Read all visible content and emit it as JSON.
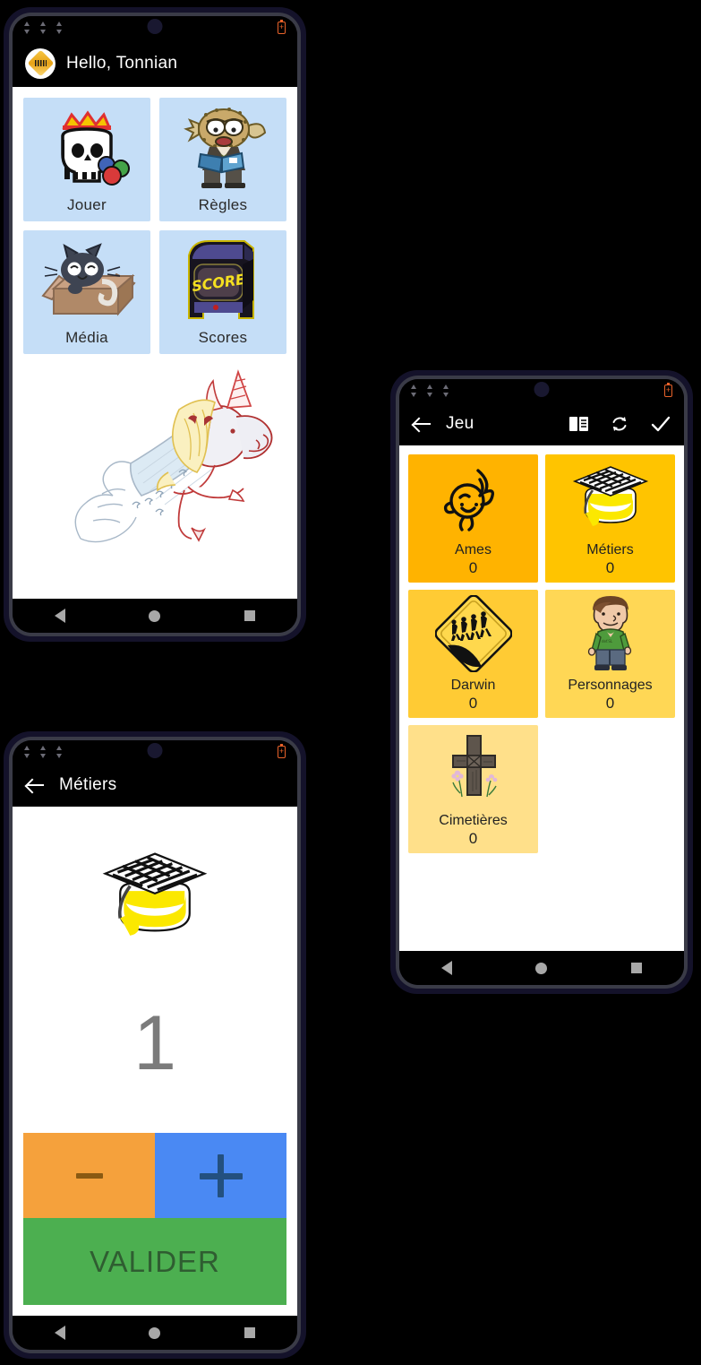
{
  "colors": {
    "tile_blue": "#c5def7",
    "amber_1": "#ffb300",
    "amber_2": "#ffc400",
    "amber_3": "#ffcb34",
    "amber_4": "#ffd755",
    "amber_5": "#ffe08a",
    "minus": "#f5a13c",
    "plus": "#4a89f3",
    "validate": "#4caf50",
    "battery": "#e8622a",
    "phone_frame": "#14122a"
  },
  "phones": {
    "home": {
      "statusbar": {
        "battery_icon": "battery-charging-icon",
        "signal_icons": [
          "data-transfer-icon",
          "data-transfer-icon",
          "data-transfer-icon"
        ]
      },
      "appbar": {
        "logo_icon": "app-logo-icon",
        "title": "Hello, Tonnian"
      },
      "tiles": [
        {
          "label": "Jouer",
          "icon": "skull-crown-icon"
        },
        {
          "label": "Règles",
          "icon": "pufferfish-teacher-icon"
        },
        {
          "label": "Média",
          "icon": "cat-in-box-icon"
        },
        {
          "label": "Scores",
          "icon": "arcade-cabinet-icon"
        }
      ],
      "hero": {
        "icon": "unicorn-mermaid-drawing"
      },
      "navbar": {
        "back": "nav-back-icon",
        "home": "nav-home-icon",
        "recents": "nav-recents-icon"
      }
    },
    "game": {
      "appbar": {
        "back_icon": "back-arrow-icon",
        "title": "Jeu",
        "actions": [
          {
            "icon": "book-icon"
          },
          {
            "icon": "refresh-icon"
          },
          {
            "icon": "check-icon"
          }
        ]
      },
      "tiles": [
        {
          "label": "Ames",
          "count": "0",
          "icon": "soul-flame-icon",
          "color": "#ffb300"
        },
        {
          "label": "Métiers",
          "count": "0",
          "icon": "graduation-cap-icon",
          "color": "#ffc400"
        },
        {
          "label": "Darwin",
          "count": "0",
          "icon": "evolution-sign-icon",
          "color": "#ffcb34"
        },
        {
          "label": "Personnages",
          "count": "0",
          "icon": "character-person-icon",
          "color": "#ffd755"
        },
        {
          "label": "Cimetières",
          "count": "0",
          "icon": "grave-cross-icon",
          "color": "#ffe08a"
        }
      ],
      "navbar": {
        "back": "nav-back-icon",
        "home": "nav-home-icon",
        "recents": "nav-recents-icon"
      }
    },
    "counter": {
      "appbar": {
        "back_icon": "back-arrow-icon",
        "title": "Métiers"
      },
      "icon": "graduation-cap-icon",
      "value": "1",
      "buttons": {
        "decrement": "−",
        "increment": "+",
        "validate": "VALIDER"
      },
      "navbar": {
        "back": "nav-back-icon",
        "home": "nav-home-icon",
        "recents": "nav-recents-icon"
      }
    }
  }
}
